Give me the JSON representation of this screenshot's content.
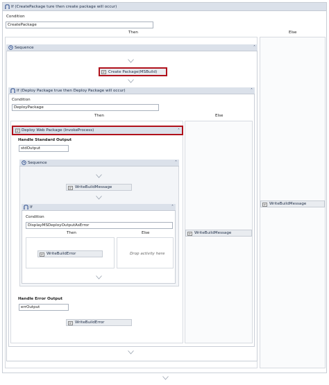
{
  "outer_if": {
    "header": "If (CreatePackage ture then create package will occur)",
    "condition_label": "Condition",
    "condition_value": "CreatePackage",
    "then_label": "Then",
    "else_label": "Else",
    "else_activity": "WriteBuildMessage"
  },
  "sequence1": {
    "header": "Sequence",
    "create_package": "Create Package(MSBuild)"
  },
  "inner_if": {
    "header": "If (Deploy Package true then Deploy Package will occur)",
    "condition_label": "Condition",
    "condition_value": "DeployPackage",
    "then_label": "Then",
    "else_label": "Else",
    "else_activity": "WriteBuildMessage"
  },
  "deploy": {
    "header": "Deploy Web Package (InvokeProcess)",
    "std_label": "Handle Standard Output",
    "std_value": "stdOutput",
    "err_label": "Handle Error Output",
    "err_value": "errOutput",
    "err_activity": "WriteBuildError"
  },
  "sequence2": {
    "header": "Sequence",
    "activity": "WriteBuildMessage"
  },
  "if3": {
    "header": "If",
    "condition_label": "Condition",
    "condition_value": "DisplayMSDeployOutputAsError",
    "then_label": "Then",
    "else_label": "Else",
    "then_activity": "WriteBuildError",
    "drop_text": "Drop activity here"
  },
  "colors": {
    "header_bg": "#dbe1ea",
    "highlight": "#b0111b",
    "border": "#c9ced6"
  },
  "icons": {
    "if": "if-icon",
    "sequence": "sequence-icon",
    "activity": "activity-icon",
    "collapse": "collapse-chevron-icon",
    "drop_arrow": "drop-arrow-icon"
  }
}
